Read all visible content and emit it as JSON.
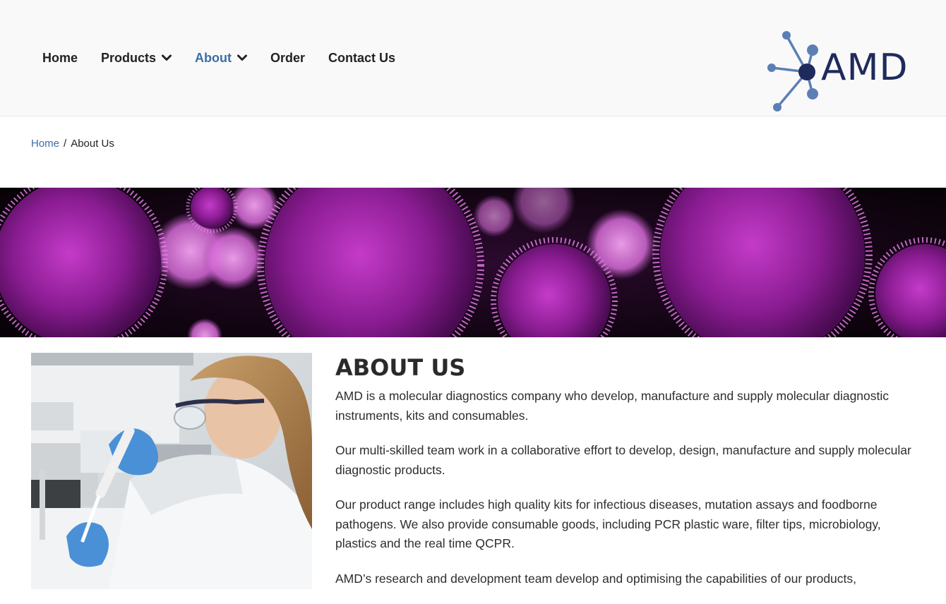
{
  "header": {
    "nav": [
      {
        "label": "Home",
        "has_dropdown": false,
        "active": false
      },
      {
        "label": "Products",
        "has_dropdown": true,
        "active": false
      },
      {
        "label": "About",
        "has_dropdown": true,
        "active": true
      },
      {
        "label": "Order",
        "has_dropdown": false,
        "active": false
      },
      {
        "label": "Contact Us",
        "has_dropdown": false,
        "active": false
      }
    ],
    "logo_text": "AMD",
    "colors": {
      "active": "#3d6ea8",
      "logo": "#1f2a5c",
      "logo_accent": "#5b7fb5"
    }
  },
  "breadcrumb": {
    "home": "Home",
    "separator": "/",
    "current": "About Us"
  },
  "banner": {
    "icon": "virus-banner-image"
  },
  "photo": {
    "icon": "lab-scientist-photo"
  },
  "about": {
    "heading": "ABOUT US",
    "paragraphs": [
      "AMD is a molecular diagnostics company who develop, manufacture and supply molecular diagnostic instruments, kits and consumables.",
      "Our multi-skilled team work in a collaborative effort to develop, design, manufacture and supply molecular diagnostic products.",
      "Our product range includes high quality kits for infectious diseases, mutation assays and foodborne pathogens. We also provide consumable goods, including PCR plastic ware, filter tips, microbiology, plastics and the real time QCPR.",
      "AMD’s research and development team develop and optimising the capabilities of our products,"
    ]
  }
}
